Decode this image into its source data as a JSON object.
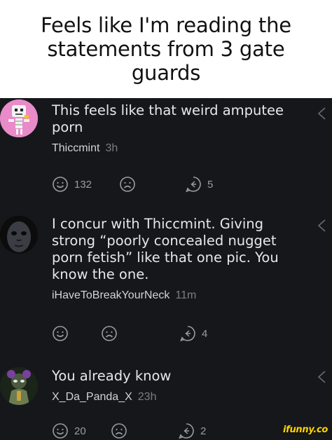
{
  "caption": "Feels like I'm reading the statements from 3 gate guards",
  "comments": [
    {
      "text": "This feels like that weird amputee porn",
      "author": "Thiccmint",
      "age": "3h",
      "upvotes": "132",
      "replies": "5",
      "avatar_icon": "skeleton-avatar-icon"
    },
    {
      "text": "I concur with Thiccmint. Giving strong “poorly concealed nugget porn fetish” like that one pic. You know the one.",
      "author": "iHaveToBreakYourNeck",
      "age": "11m",
      "upvotes": "",
      "replies": "4",
      "avatar_icon": "masked-face-avatar-icon"
    },
    {
      "text": "You already know",
      "author": "X_Da_Panda_X",
      "age": "23h",
      "upvotes": "20",
      "replies": "2",
      "avatar_icon": "panda-character-avatar-icon"
    }
  ],
  "watermark": "ifunny.co",
  "colors": {
    "background": "#16171b",
    "text": "#e8e8ea",
    "muted": "#7c7d83",
    "brand": "#ffd400"
  }
}
